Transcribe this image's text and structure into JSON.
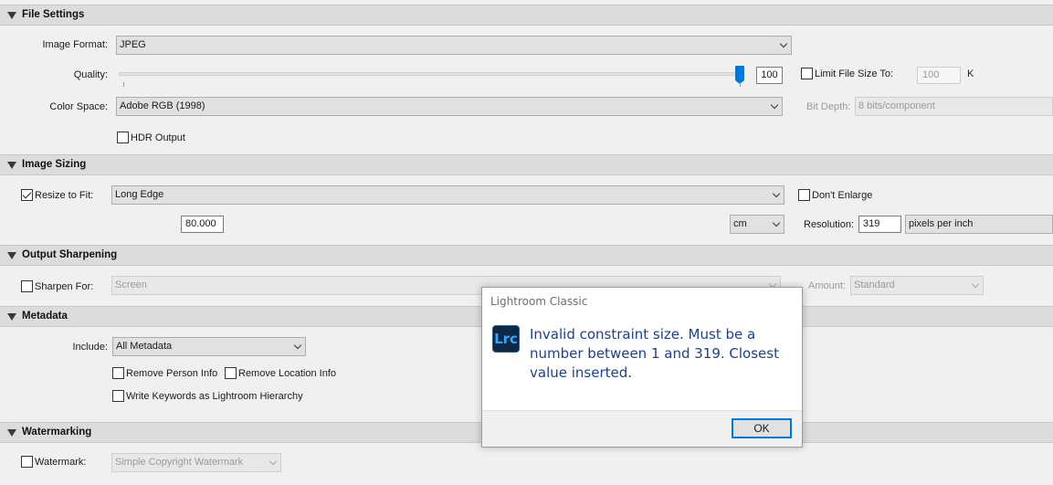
{
  "sections": {
    "file_settings": "File Settings",
    "image_sizing": "Image Sizing",
    "output_sharpening": "Output Sharpening",
    "metadata": "Metadata",
    "watermarking": "Watermarking"
  },
  "file_settings": {
    "image_format_label": "Image Format:",
    "image_format_value": "JPEG",
    "quality_label": "Quality:",
    "quality_value": "100",
    "quality_fraction": 1.0,
    "limit_size_label": "Limit File Size To:",
    "limit_size_checked": false,
    "limit_size_value": "100",
    "limit_size_unit": "K",
    "color_space_label": "Color Space:",
    "color_space_value": "Adobe RGB (1998)",
    "bit_depth_label": "Bit Depth:",
    "bit_depth_value": "8 bits/component",
    "hdr_label": "HDR Output",
    "hdr_checked": false
  },
  "image_sizing": {
    "resize_label": "Resize to Fit:",
    "resize_checked": true,
    "resize_mode": "Long Edge",
    "dont_enlarge_label": "Don't Enlarge",
    "dont_enlarge_checked": false,
    "size_value": "80.000",
    "unit_value": "cm",
    "resolution_label": "Resolution:",
    "resolution_value": "319",
    "resolution_unit": "pixels per inch"
  },
  "output_sharpening": {
    "sharpen_label": "Sharpen For:",
    "sharpen_checked": false,
    "sharpen_value": "Screen",
    "amount_label": "Amount:",
    "amount_value": "Standard"
  },
  "metadata": {
    "include_label": "Include:",
    "include_value": "All Metadata",
    "remove_person_label": "Remove Person Info",
    "remove_location_label": "Remove Location Info",
    "keywords_label": "Write Keywords as Lightroom Hierarchy"
  },
  "watermarking": {
    "watermark_label": "Watermark:",
    "watermark_checked": false,
    "watermark_value": "Simple Copyright Watermark"
  },
  "dialog": {
    "title": "Lightroom Classic",
    "icon_text": "Lrc",
    "message": "Invalid constraint size. Must be a number between 1 and 319. Closest value inserted.",
    "ok_label": "OK"
  },
  "colors": {
    "accent": "#0078d7",
    "message_text": "#1d3f8c",
    "icon_bg": "#0c2a45",
    "icon_fg": "#31a8ff"
  }
}
